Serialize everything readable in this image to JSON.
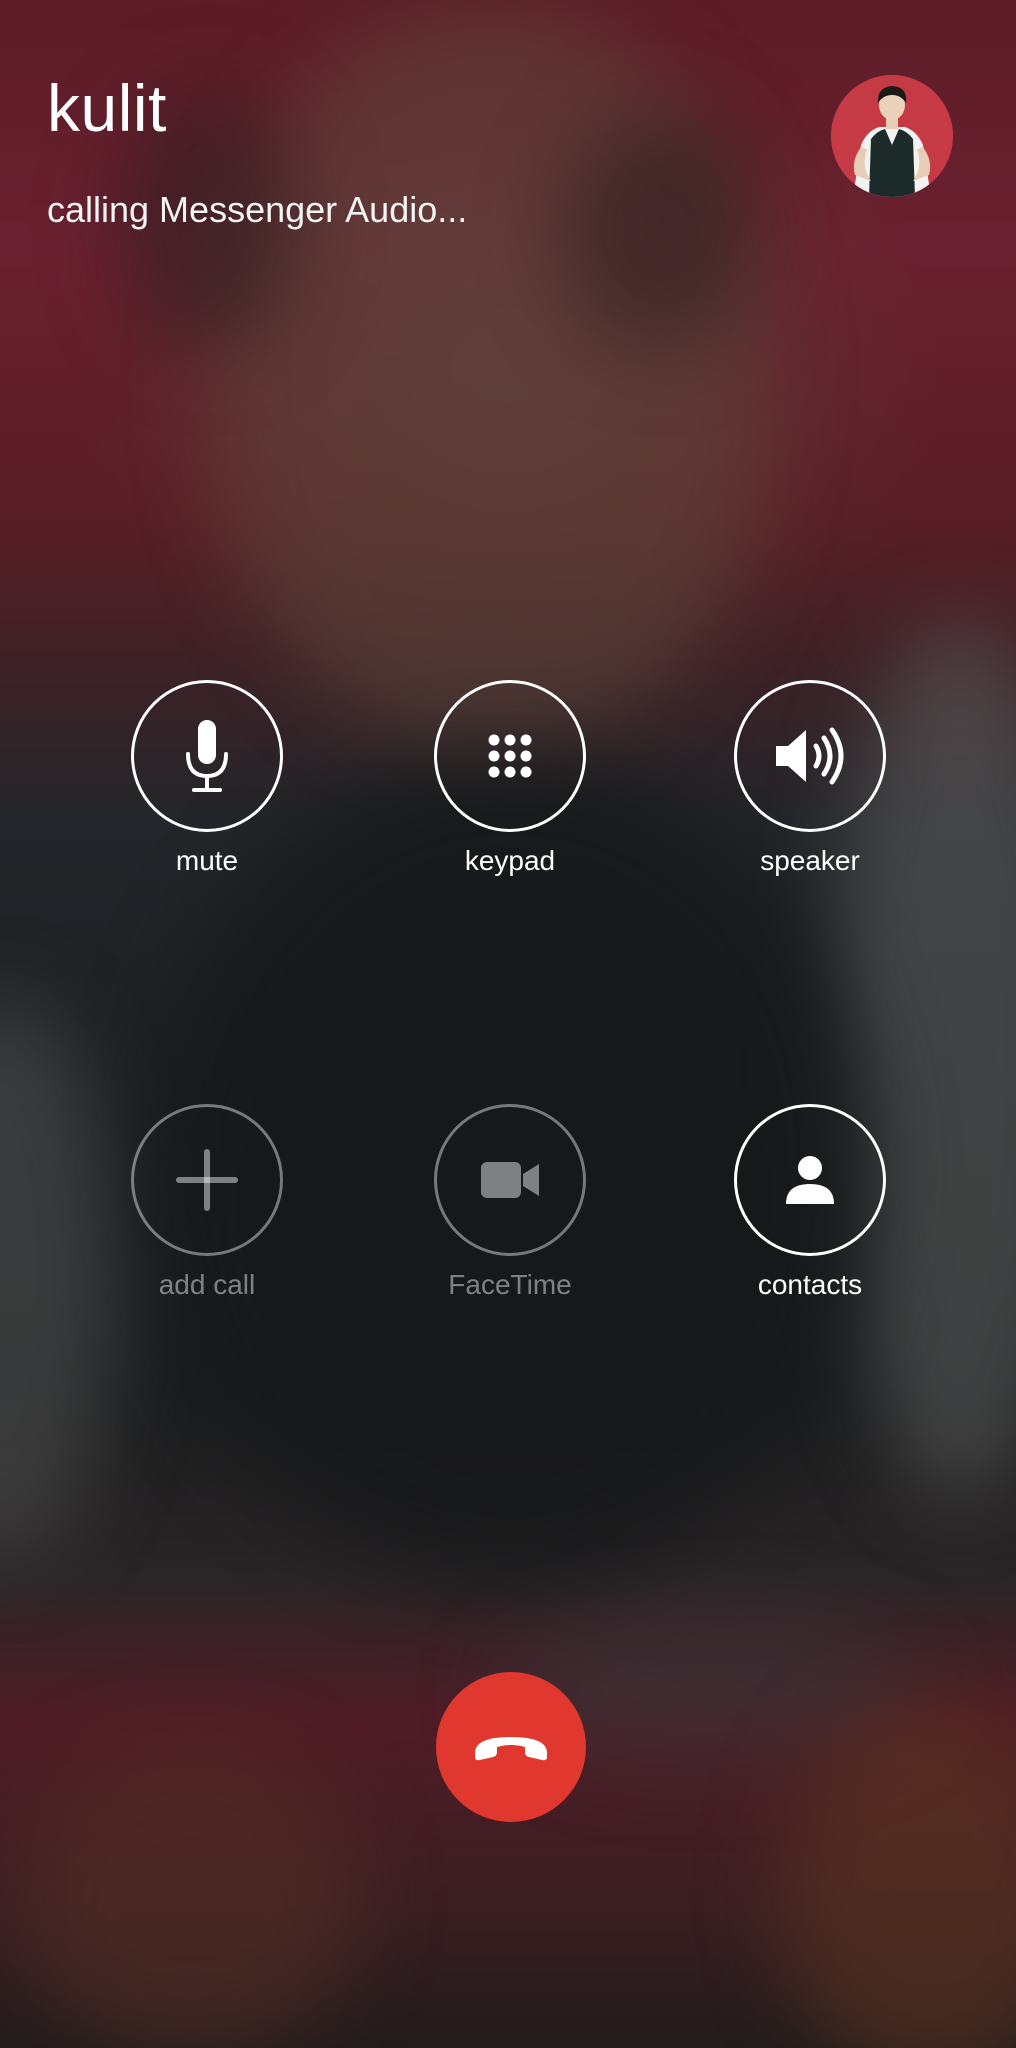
{
  "call": {
    "caller_name": "kulit",
    "status": "calling Messenger Audio..."
  },
  "avatar": {
    "icon": "contact-photo"
  },
  "controls": {
    "mute": {
      "label": "mute",
      "icon": "microphone-icon",
      "enabled": true
    },
    "keypad": {
      "label": "keypad",
      "icon": "keypad-icon",
      "enabled": true
    },
    "speaker": {
      "label": "speaker",
      "icon": "speaker-icon",
      "enabled": true
    },
    "add_call": {
      "label": "add call",
      "icon": "plus-icon",
      "enabled": false
    },
    "facetime": {
      "label": "FaceTime",
      "icon": "video-camera-icon",
      "enabled": false
    },
    "contacts": {
      "label": "contacts",
      "icon": "person-icon",
      "enabled": true
    }
  },
  "end_call": {
    "icon": "phone-hangup-icon"
  },
  "colors": {
    "end_call": "#e0372f",
    "avatar_bg": "#c63a45",
    "button_ring": "#ffffff",
    "disabled_ring": "rgba(255,255,255,0.42)"
  }
}
